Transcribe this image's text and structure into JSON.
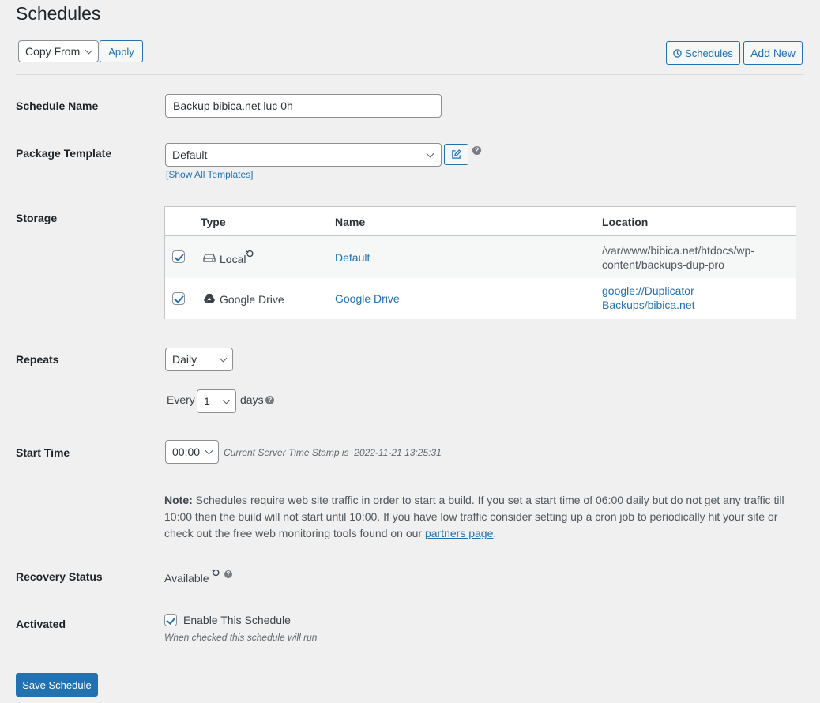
{
  "page": {
    "title": "Schedules"
  },
  "toolbar": {
    "copy_from_select": "Copy From",
    "apply_button": "Apply",
    "schedules_button": "Schedules",
    "add_new_button": "Add New"
  },
  "form": {
    "schedule_name": {
      "label": "Schedule Name",
      "value": "Backup bibica.net luc 0h"
    },
    "package_template": {
      "label": "Package Template",
      "selected": "Default",
      "show_all_link": "[Show All Templates]"
    },
    "storage": {
      "label": "Storage",
      "columns": [
        "Type",
        "Name",
        "Location"
      ],
      "rows": [
        {
          "checked": true,
          "icon": "hard-drive-icon",
          "type": "Local",
          "name": "Default",
          "location_line1": "/var/www/bibica.net/htdocs/wp-",
          "location_line2": "content/backups-dup-pro",
          "location_is_link": false
        },
        {
          "checked": true,
          "icon": "google-drive-icon",
          "type": "Google Drive",
          "name": "Google Drive",
          "location_line1": "google://Duplicator",
          "location_line2": "Backups/bibica.net",
          "location_is_link": true
        }
      ]
    },
    "repeats": {
      "label": "Repeats",
      "selected": "Daily",
      "every_label": "Every",
      "every_value": "1",
      "unit_label": "days"
    },
    "start_time": {
      "label": "Start Time",
      "selected": "00:00",
      "server_time_label": "Current Server Time Stamp is",
      "server_time_value": "2022-11-21 13:25:31"
    },
    "note": {
      "prefix": "Note:",
      "text": " Schedules require web site traffic in order to start a build. If you set a start time of 06:00 daily but do not get any traffic till 10:00 then the build will not start until 10:00. If you have low traffic consider setting up a cron job to periodically hit your site or check out the free web monitoring tools found on our ",
      "link": "partners page",
      "suffix": "."
    },
    "recovery_status": {
      "label": "Recovery Status",
      "value": "Available"
    },
    "activated": {
      "label": "Activated",
      "checked": true,
      "checkbox_label": "Enable This Schedule",
      "hint": "When checked this schedule will run"
    }
  },
  "footer": {
    "save_button": "Save Schedule"
  },
  "colors": {
    "accent": "#2271b1",
    "background": "#f0f0f1",
    "border": "#8c8f94"
  }
}
